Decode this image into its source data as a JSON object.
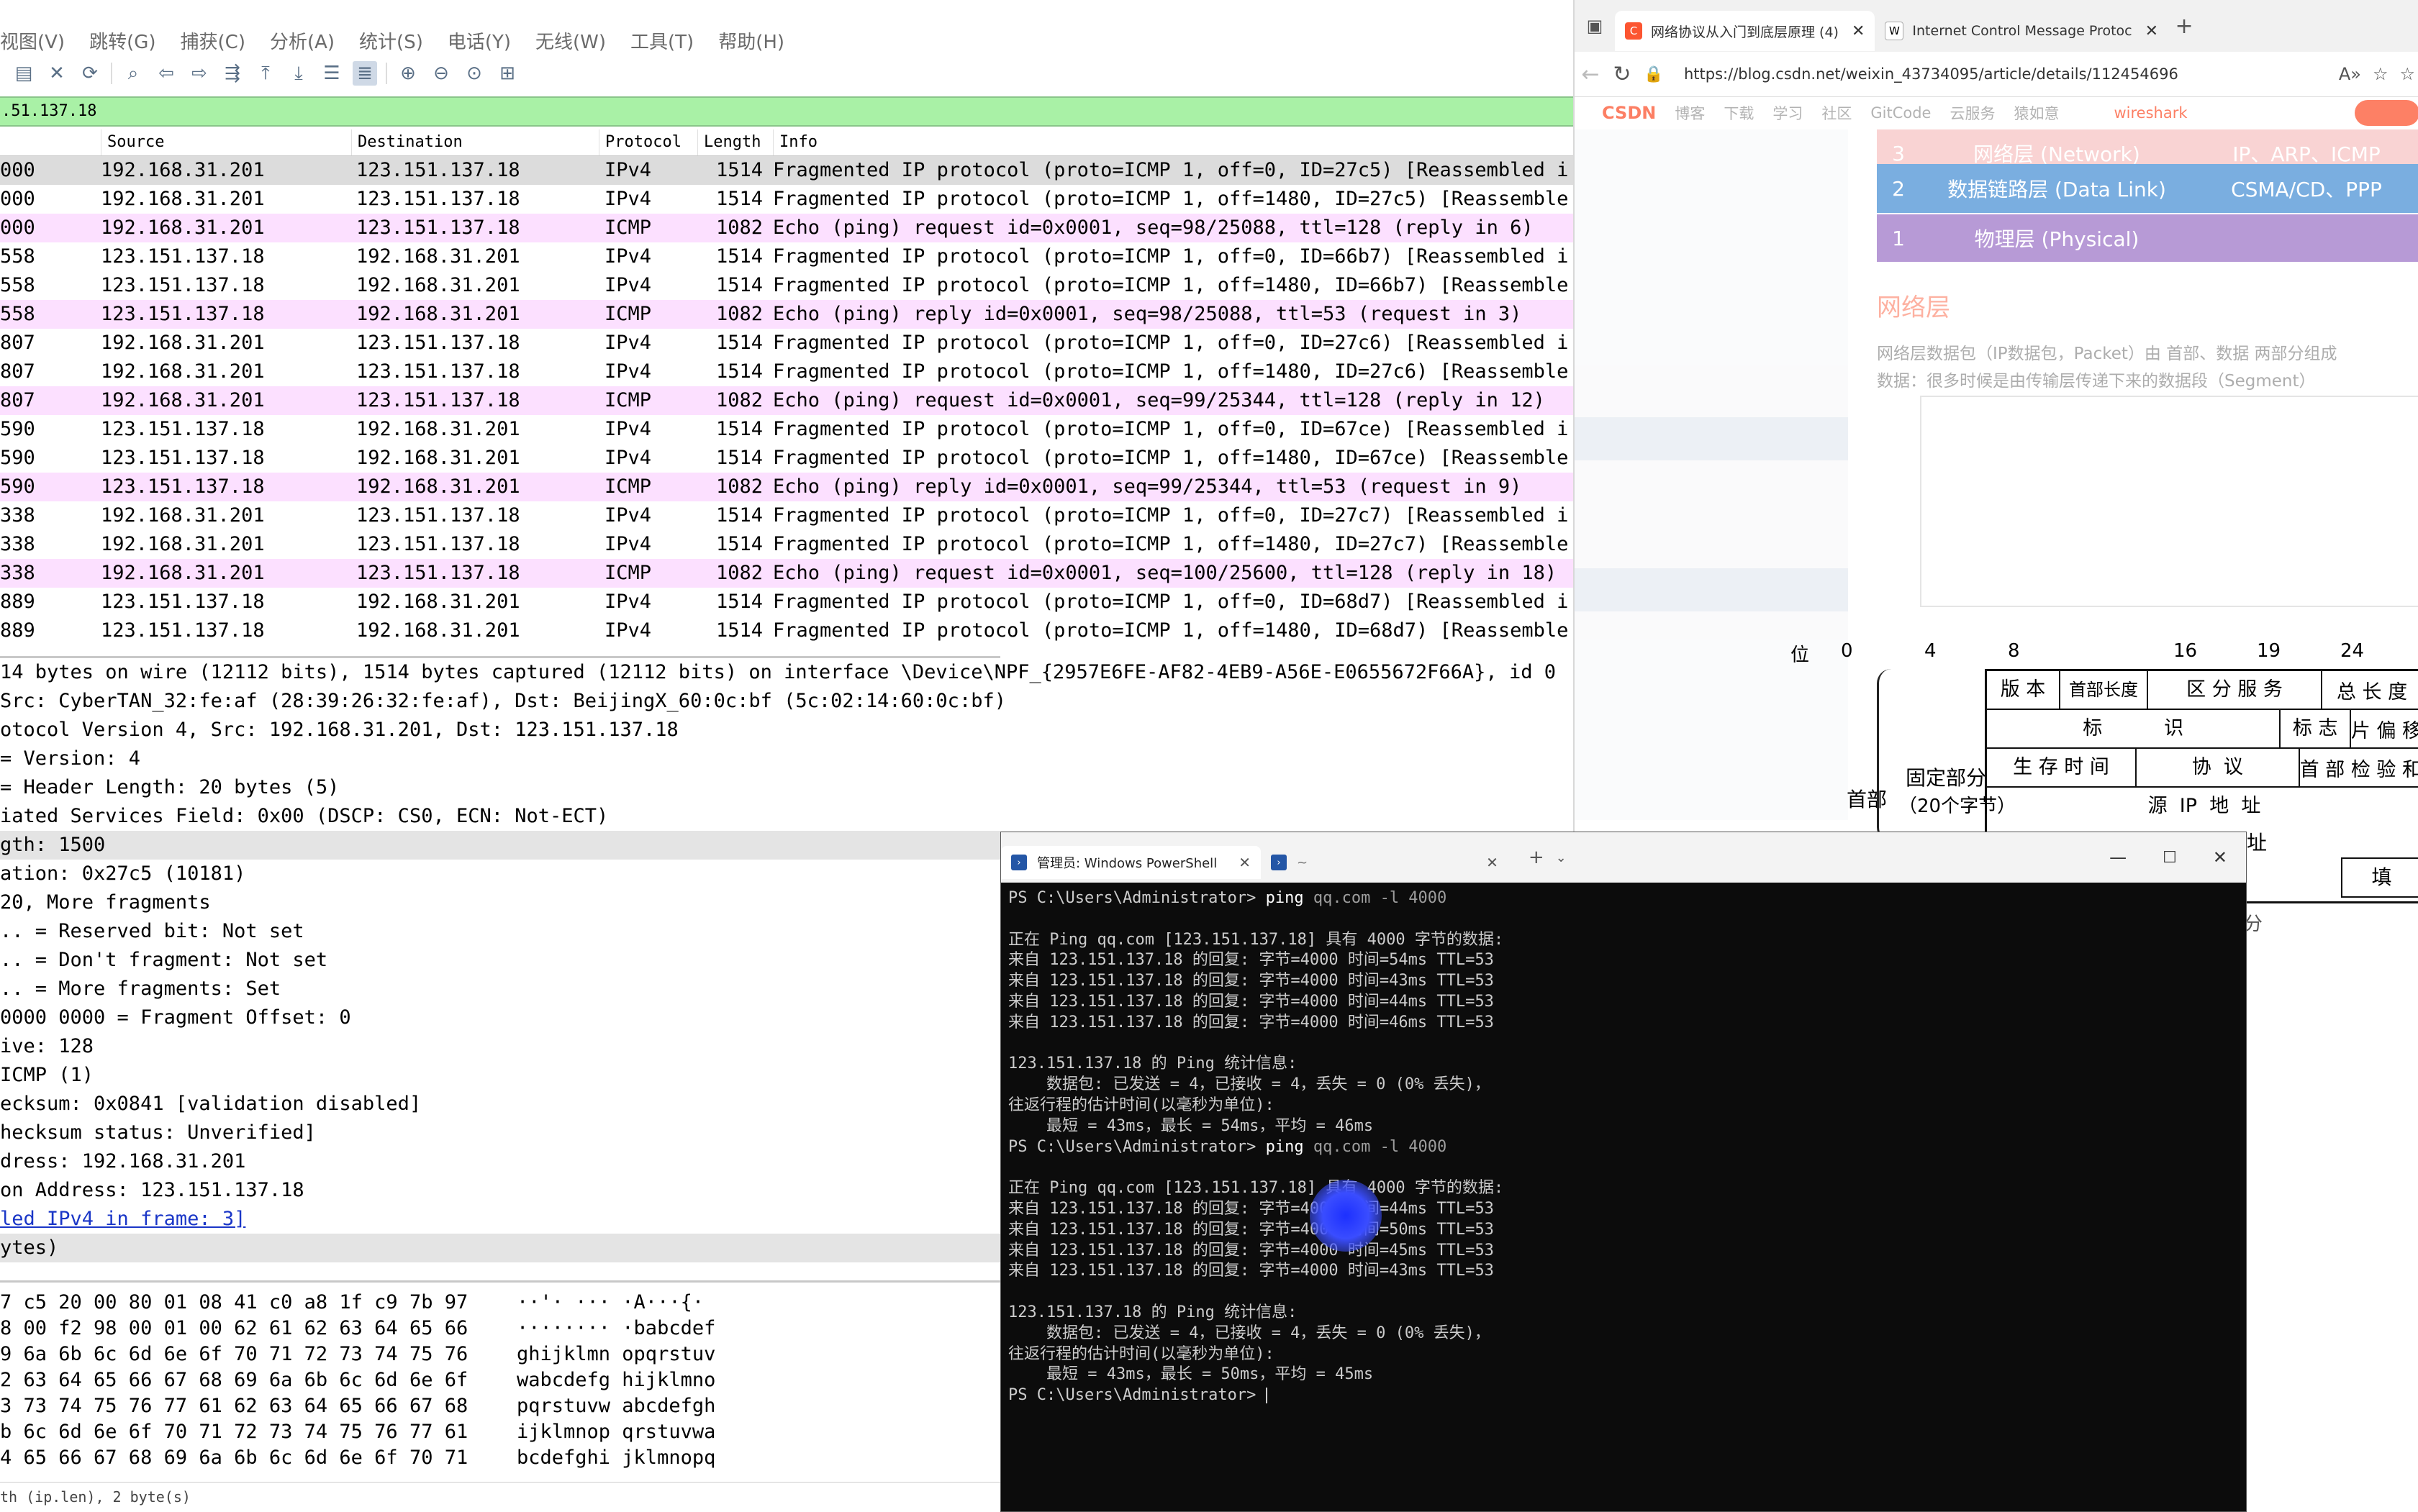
{
  "wireshark": {
    "menu": [
      "视图(V)",
      "跳转(G)",
      "捕获(C)",
      "分析(A)",
      "统计(S)",
      "电话(Y)",
      "无线(W)",
      "工具(T)",
      "帮助(H)"
    ],
    "filter_text": ".51.137.18",
    "columns": {
      "source": "Source",
      "destination": "Destination",
      "protocol": "Protocol",
      "length": "Length",
      "info": "Info"
    },
    "packets": [
      {
        "no": "000",
        "src": "192.168.31.201",
        "dst": "123.151.137.18",
        "proto": "IPv4",
        "len": "1514",
        "info": "Fragmented IP protocol (proto=ICMP 1, off=0, ID=27c5) [Reassembled i",
        "style": "sel"
      },
      {
        "no": "000",
        "src": "192.168.31.201",
        "dst": "123.151.137.18",
        "proto": "IPv4",
        "len": "1514",
        "info": "Fragmented IP protocol (proto=ICMP 1, off=1480, ID=27c5) [Reassemble",
        "style": "ipv4"
      },
      {
        "no": "000",
        "src": "192.168.31.201",
        "dst": "123.151.137.18",
        "proto": "ICMP",
        "len": "1082",
        "info": "Echo (ping) request  id=0x0001, seq=98/25088, ttl=128 (reply in 6)",
        "style": "icmp"
      },
      {
        "no": "558",
        "src": "123.151.137.18",
        "dst": "192.168.31.201",
        "proto": "IPv4",
        "len": "1514",
        "info": "Fragmented IP protocol (proto=ICMP 1, off=0, ID=66b7) [Reassembled i",
        "style": "ipv4"
      },
      {
        "no": "558",
        "src": "123.151.137.18",
        "dst": "192.168.31.201",
        "proto": "IPv4",
        "len": "1514",
        "info": "Fragmented IP protocol (proto=ICMP 1, off=1480, ID=66b7) [Reassemble",
        "style": "ipv4"
      },
      {
        "no": "558",
        "src": "123.151.137.18",
        "dst": "192.168.31.201",
        "proto": "ICMP",
        "len": "1082",
        "info": "Echo (ping) reply    id=0x0001, seq=98/25088, ttl=53 (request in 3)",
        "style": "icmp"
      },
      {
        "no": "807",
        "src": "192.168.31.201",
        "dst": "123.151.137.18",
        "proto": "IPv4",
        "len": "1514",
        "info": "Fragmented IP protocol (proto=ICMP 1, off=0, ID=27c6) [Reassembled i",
        "style": "ipv4"
      },
      {
        "no": "807",
        "src": "192.168.31.201",
        "dst": "123.151.137.18",
        "proto": "IPv4",
        "len": "1514",
        "info": "Fragmented IP protocol (proto=ICMP 1, off=1480, ID=27c6) [Reassemble",
        "style": "ipv4"
      },
      {
        "no": "807",
        "src": "192.168.31.201",
        "dst": "123.151.137.18",
        "proto": "ICMP",
        "len": "1082",
        "info": "Echo (ping) request  id=0x0001, seq=99/25344, ttl=128 (reply in 12)",
        "style": "icmp"
      },
      {
        "no": "590",
        "src": "123.151.137.18",
        "dst": "192.168.31.201",
        "proto": "IPv4",
        "len": "1514",
        "info": "Fragmented IP protocol (proto=ICMP 1, off=0, ID=67ce) [Reassembled i",
        "style": "ipv4"
      },
      {
        "no": "590",
        "src": "123.151.137.18",
        "dst": "192.168.31.201",
        "proto": "IPv4",
        "len": "1514",
        "info": "Fragmented IP protocol (proto=ICMP 1, off=1480, ID=67ce) [Reassemble",
        "style": "ipv4"
      },
      {
        "no": "590",
        "src": "123.151.137.18",
        "dst": "192.168.31.201",
        "proto": "ICMP",
        "len": "1082",
        "info": "Echo (ping) reply    id=0x0001, seq=99/25344, ttl=53 (request in 9)",
        "style": "icmp"
      },
      {
        "no": "338",
        "src": "192.168.31.201",
        "dst": "123.151.137.18",
        "proto": "IPv4",
        "len": "1514",
        "info": "Fragmented IP protocol (proto=ICMP 1, off=0, ID=27c7) [Reassembled i",
        "style": "ipv4"
      },
      {
        "no": "338",
        "src": "192.168.31.201",
        "dst": "123.151.137.18",
        "proto": "IPv4",
        "len": "1514",
        "info": "Fragmented IP protocol (proto=ICMP 1, off=1480, ID=27c7) [Reassemble",
        "style": "ipv4"
      },
      {
        "no": "338",
        "src": "192.168.31.201",
        "dst": "123.151.137.18",
        "proto": "ICMP",
        "len": "1082",
        "info": "Echo (ping) request  id=0x0001, seq=100/25600, ttl=128 (reply in 18)",
        "style": "icmp"
      },
      {
        "no": "889",
        "src": "123.151.137.18",
        "dst": "192.168.31.201",
        "proto": "IPv4",
        "len": "1514",
        "info": "Fragmented IP protocol (proto=ICMP 1, off=0, ID=68d7) [Reassembled i",
        "style": "ipv4"
      },
      {
        "no": "889",
        "src": "123.151.137.18",
        "dst": "192.168.31.201",
        "proto": "IPv4",
        "len": "1514",
        "info": "Fragmented IP protocol (proto=ICMP 1, off=1480, ID=68d7) [Reassemble",
        "style": "ipv4"
      }
    ],
    "detail_top": [
      "14 bytes on wire (12112 bits), 1514 bytes captured (12112 bits) on interface \\Device\\NPF_{2957E6FE-AF82-4EB9-A56E-E0655672F66A}, id 0",
      " Src: CyberTAN_32:fe:af (28:39:26:32:fe:af), Dst: BeijingX_60:0c:bf (5c:02:14:60:0c:bf)",
      "otocol Version 4, Src: 192.168.31.201, Dst: 123.151.137.18"
    ],
    "details": [
      {
        "text": " = Version: 4",
        "hl": false,
        "link": false
      },
      {
        "text": " = Header Length: 20 bytes (5)",
        "hl": false,
        "link": false
      },
      {
        "text": "iated Services Field: 0x00 (DSCP: CS0, ECN: Not-ECT)",
        "hl": false,
        "link": false
      },
      {
        "text": "gth: 1500",
        "hl": true,
        "link": false
      },
      {
        "text": "ation: 0x27c5 (10181)",
        "hl": false,
        "link": false
      },
      {
        "text": "20, More fragments",
        "hl": false,
        "link": false
      },
      {
        "text": ".. = Reserved bit: Not set",
        "hl": false,
        "link": false
      },
      {
        "text": ".. = Don't fragment: Not set",
        "hl": false,
        "link": false
      },
      {
        "text": ".. = More fragments: Set",
        "hl": false,
        "link": false
      },
      {
        "text": " 0000 0000 = Fragment Offset: 0",
        "hl": false,
        "link": false
      },
      {
        "text": "ive: 128",
        "hl": false,
        "link": false
      },
      {
        "text": " ICMP (1)",
        "hl": false,
        "link": false
      },
      {
        "text": "ecksum: 0x0841 [validation disabled]",
        "hl": false,
        "link": false
      },
      {
        "text": "hecksum status: Unverified]",
        "hl": false,
        "link": false
      },
      {
        "text": "dress: 192.168.31.201",
        "hl": false,
        "link": false
      },
      {
        "text": "on Address: 123.151.137.18",
        "hl": false,
        "link": false
      },
      {
        "text": "led IPv4 in frame: 3]",
        "hl": false,
        "link": true
      },
      {
        "text": "ytes)",
        "hl": true,
        "link": false
      }
    ],
    "hex": [
      {
        "bytes": "7 c5 20 00 80 01  08 41 c0 a8 1f c9 7b 97",
        "ascii": "··'· ··· ·A···{·"
      },
      {
        "bytes": "8 00 f2 98 00 01  00 62 61 62 63 64 65 66",
        "ascii": "········ ·babcdef"
      },
      {
        "bytes": "9 6a 6b 6c 6d 6e  6f 70 71 72 73 74 75 76",
        "ascii": "ghijklmn opqrstuv"
      },
      {
        "bytes": "2 63 64 65 66 67  68 69 6a 6b 6c 6d 6e 6f",
        "ascii": "wabcdefg hijklmno"
      },
      {
        "bytes": "3 73 74 75 76 77  61 62 63 64 65 66 67 68",
        "ascii": "pqrstuvw abcdefgh"
      },
      {
        "bytes": "b 6c 6d 6e 6f 70  71 72 73 74 75 76 77 61",
        "ascii": "ijklmnop qrstuvwa"
      },
      {
        "bytes": "4 65 66 67 68 69  6a 6b 6c 6d 6e 6f 70 71",
        "ascii": "bcdefghi jklmnopq"
      }
    ],
    "status": "th (ip.len), 2 byte(s)"
  },
  "browser": {
    "tabs": [
      {
        "title": "网络协议从入门到底层原理 (4)",
        "favicon": "C",
        "active": true
      },
      {
        "title": "Internet Control Message Protoc",
        "favicon": "W",
        "active": false
      }
    ],
    "url": "https://blog.csdn.net/weixin_43734095/article/details/112454696",
    "nav": [
      "CSDN",
      "博客",
      "下载",
      "学习",
      "社区",
      "GitCode",
      "云服务",
      "猿如意",
      "wireshark"
    ],
    "osi_rows": [
      {
        "num": "3",
        "name": "网络层 (Network)",
        "proto": "IP、ARP、ICMP",
        "color": "#f5a8a8"
      },
      {
        "num": "2",
        "name": "数据链路层 (Data Link)",
        "proto": "CSMA/CD、PPP",
        "color": "#7aaee0"
      },
      {
        "num": "1",
        "name": "物理层 (Physical)",
        "proto": "",
        "color": "#b79ad6"
      }
    ],
    "section_title": "网络层",
    "para1": "网络层数据包（IP数据包，Packet）由 首部、数据 两部分组成",
    "para2": "数据：很多时候是由传输层传递下来的数据段（Segment）",
    "header_diagram": {
      "bit_labels": [
        "位",
        "0",
        "4",
        "8",
        "16",
        "19",
        "24"
      ],
      "row1": [
        "版 本",
        "首部长度",
        "区 分 服 务",
        "总 长 度"
      ],
      "row2": [
        "标          识",
        "标 志",
        "片 偏 移"
      ],
      "row3": [
        "生 存 时 间",
        "协  议",
        "首 部 检 验 和"
      ],
      "row4": "源  IP  地  址",
      "row5": "址",
      "left_label_1": "首部",
      "left_label_2": "固定部分",
      "left_label_3": "（20个字节）",
      "right_edge": "填",
      "tail": "分"
    }
  },
  "powershell": {
    "tab_title": "管理员: Windows PowerShell",
    "lines": [
      {
        "t": "prompt",
        "p": "PS C:\\Users\\Administrator> ",
        "cmd": "ping",
        "args": " qq.com -l 4000"
      },
      {
        "t": "blank"
      },
      {
        "t": "text",
        "v": "正在 Ping qq.com [123.151.137.18] 具有 4000 字节的数据:"
      },
      {
        "t": "text",
        "v": "来自 123.151.137.18 的回复: 字节=4000 时间=54ms TTL=53"
      },
      {
        "t": "text",
        "v": "来自 123.151.137.18 的回复: 字节=4000 时间=43ms TTL=53"
      },
      {
        "t": "text",
        "v": "来自 123.151.137.18 的回复: 字节=4000 时间=44ms TTL=53"
      },
      {
        "t": "text",
        "v": "来自 123.151.137.18 的回复: 字节=4000 时间=46ms TTL=53"
      },
      {
        "t": "blank"
      },
      {
        "t": "text",
        "v": "123.151.137.18 的 Ping 统计信息:"
      },
      {
        "t": "text",
        "v": "    数据包: 已发送 = 4，已接收 = 4，丢失 = 0 (0% 丢失)，"
      },
      {
        "t": "text",
        "v": "往返行程的估计时间(以毫秒为单位):"
      },
      {
        "t": "text",
        "v": "    最短 = 43ms，最长 = 54ms，平均 = 46ms"
      },
      {
        "t": "prompt",
        "p": "PS C:\\Users\\Administrator> ",
        "cmd": "ping",
        "args": " qq.com -l 4000"
      },
      {
        "t": "blank"
      },
      {
        "t": "text",
        "v": "正在 Ping qq.com [123.151.137.18] 具有 4000 字节的数据:"
      },
      {
        "t": "text",
        "v": "来自 123.151.137.18 的回复: 字节=4000 时间=44ms TTL=53"
      },
      {
        "t": "text",
        "v": "来自 123.151.137.18 的回复: 字节=4000 时间=50ms TTL=53"
      },
      {
        "t": "text",
        "v": "来自 123.151.137.18 的回复: 字节=4000 时间=45ms TTL=53"
      },
      {
        "t": "text",
        "v": "来自 123.151.137.18 的回复: 字节=4000 时间=43ms TTL=53"
      },
      {
        "t": "blank"
      },
      {
        "t": "text",
        "v": "123.151.137.18 的 Ping 统计信息:"
      },
      {
        "t": "text",
        "v": "    数据包: 已发送 = 4，已接收 = 4，丢失 = 0 (0% 丢失)，"
      },
      {
        "t": "text",
        "v": "往返行程的估计时间(以毫秒为单位):"
      },
      {
        "t": "text",
        "v": "    最短 = 43ms，最长 = 50ms，平均 = 45ms"
      },
      {
        "t": "prompt_end",
        "p": "PS C:\\Users\\Administrator> "
      }
    ]
  }
}
